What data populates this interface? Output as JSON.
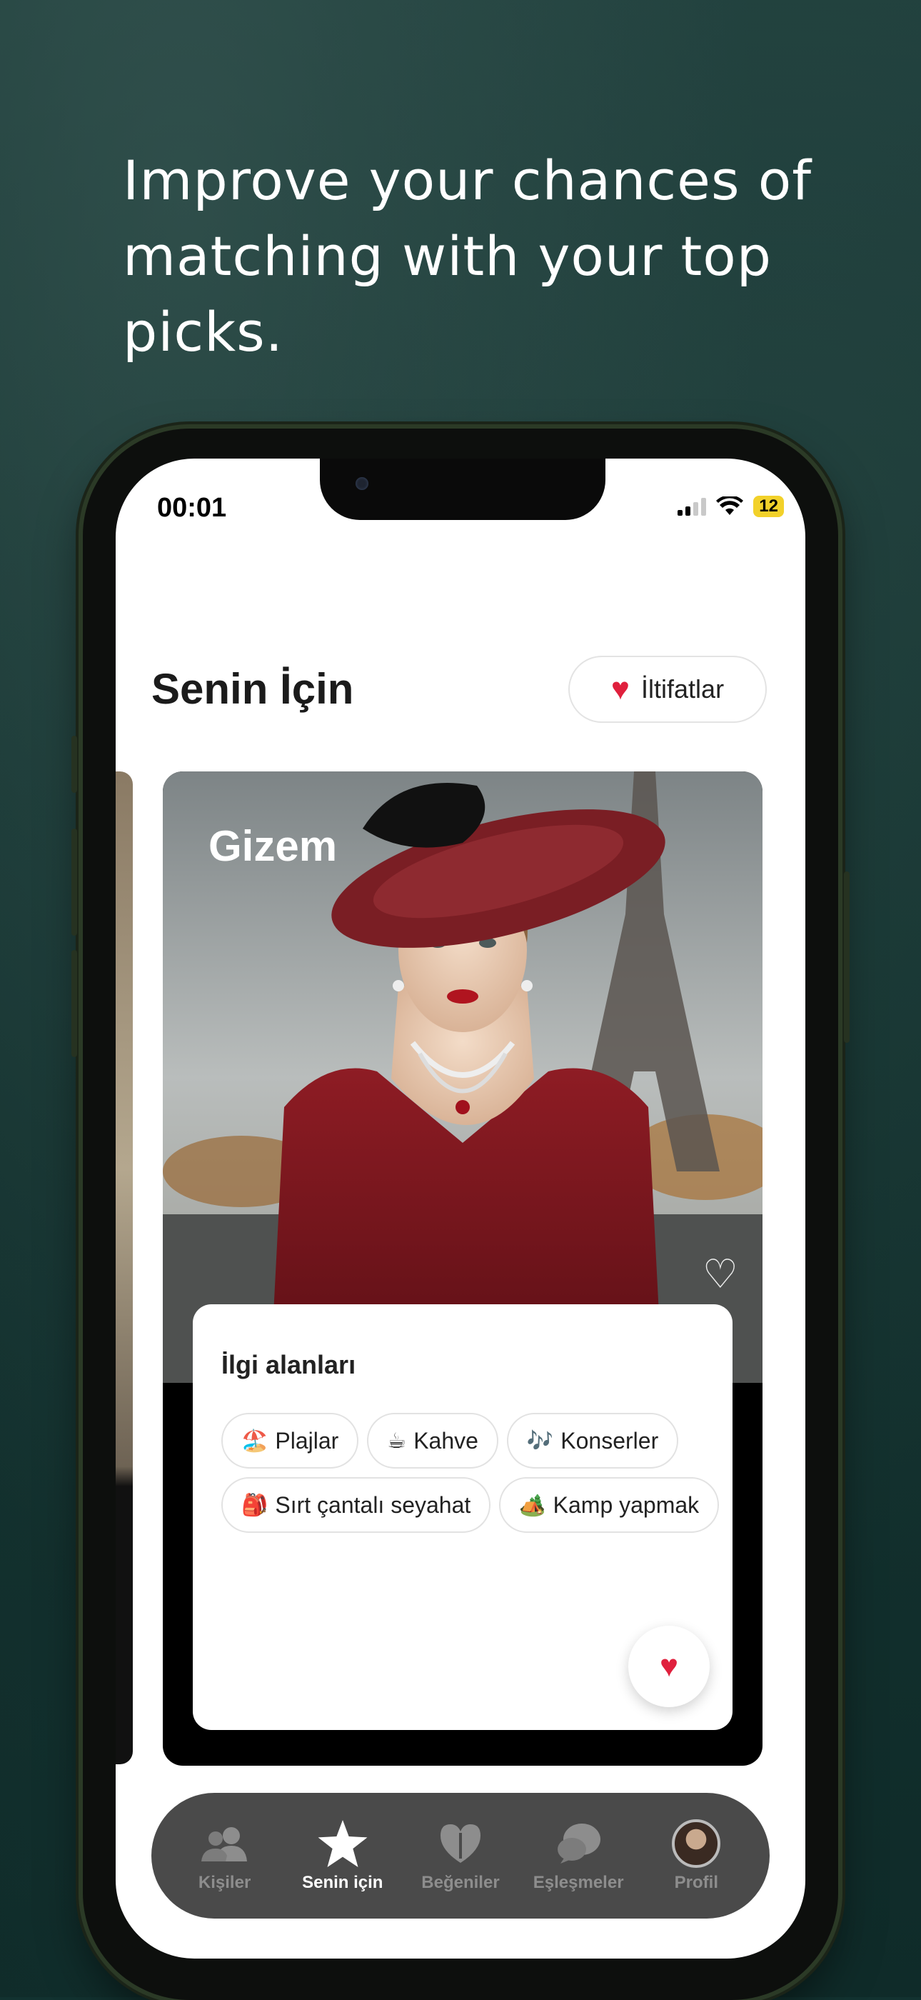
{
  "headline": "Improve your chances of matching with your top picks.",
  "status_bar": {
    "time": "00:01",
    "battery": "12"
  },
  "header": {
    "title": "Senin İçin",
    "compliments_label": "İltifatlar"
  },
  "profile_card": {
    "name": "Gizem",
    "interests_title": "İlgi alanları",
    "interests": [
      {
        "emoji": "🏖️",
        "label": "Plajlar"
      },
      {
        "emoji": "☕",
        "label": "Kahve"
      },
      {
        "emoji": "🎶",
        "label": "Konserler"
      },
      {
        "emoji": "🎒",
        "label": "Sırt çantalı seyahat"
      },
      {
        "emoji": "🏕️",
        "label": "Kamp yapmak"
      }
    ]
  },
  "tabbar": {
    "items": [
      {
        "label": "Kişiler",
        "icon": "people-icon"
      },
      {
        "label": "Senin için",
        "icon": "star-icon",
        "active": true
      },
      {
        "label": "Beğeniler",
        "icon": "heart-shield-icon"
      },
      {
        "label": "Eşleşmeler",
        "icon": "chat-bubbles-icon"
      },
      {
        "label": "Profil",
        "icon": "avatar"
      }
    ]
  },
  "colors": {
    "accent": "#e0203d",
    "background": "#123230",
    "tabbar": "#4a4a4a"
  }
}
